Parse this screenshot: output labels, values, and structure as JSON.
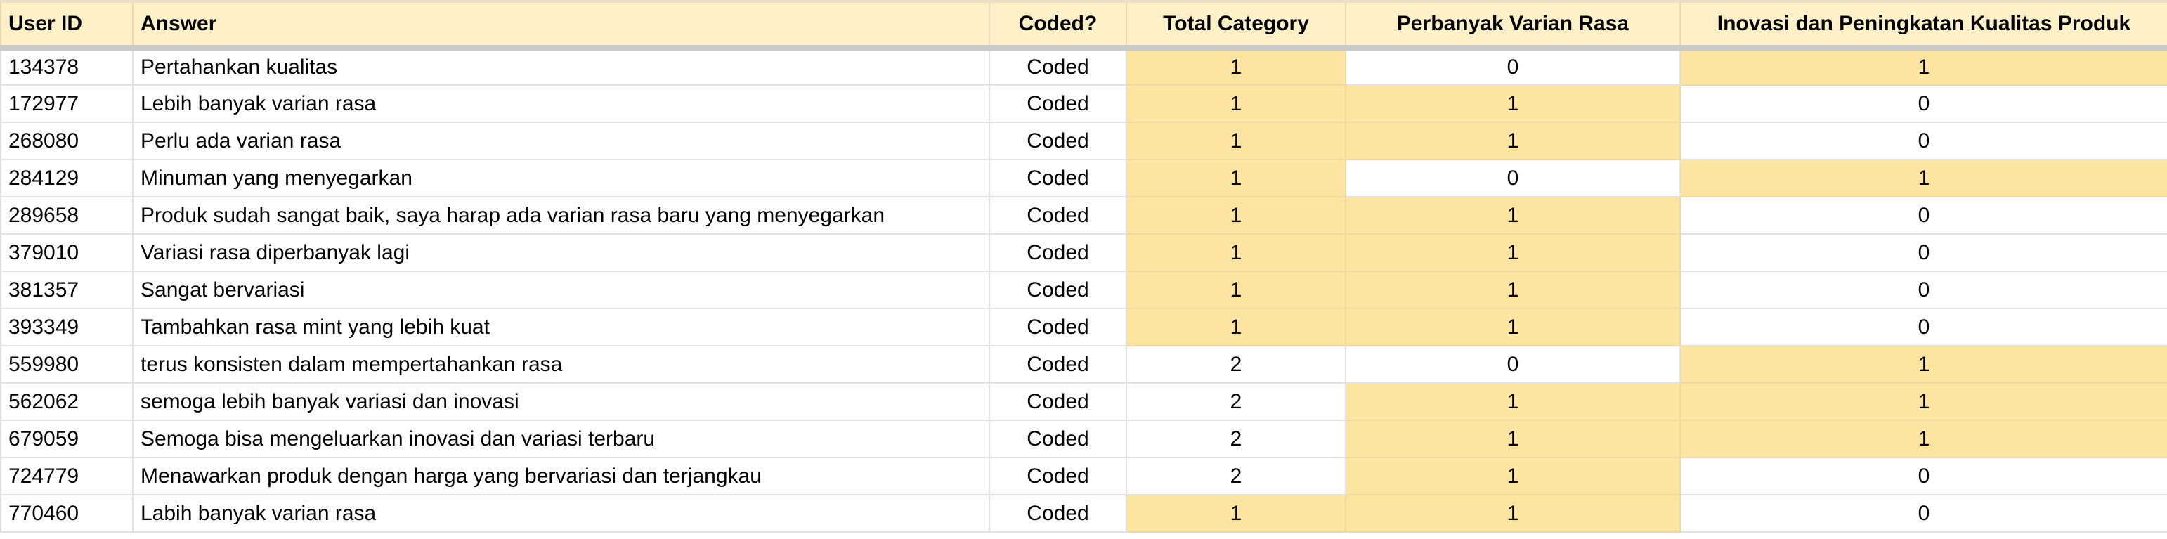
{
  "sheet": {
    "columns": [
      {
        "key": "user_id",
        "label": "User ID"
      },
      {
        "key": "answer",
        "label": "Answer"
      },
      {
        "key": "coded",
        "label": "Coded?"
      },
      {
        "key": "total_category",
        "label": "Total Category"
      },
      {
        "key": "perbanyak_varian_rasa",
        "label": "Perbanyak Varian Rasa"
      },
      {
        "key": "inovasi",
        "label": "Inovasi dan Peningkatan Kualitas Produk"
      }
    ],
    "highlight_color": "#fde4a1",
    "header_color": "#fef1c7",
    "rows": [
      {
        "user_id": "134378",
        "answer": "Pertahankan kualitas",
        "coded": "Coded",
        "total_category": "1",
        "perbanyak_varian_rasa": "0",
        "inovasi": "1",
        "hl": [
          false,
          false,
          false,
          true,
          false,
          true
        ]
      },
      {
        "user_id": "172977",
        "answer": "Lebih banyak varian rasa",
        "coded": "Coded",
        "total_category": "1",
        "perbanyak_varian_rasa": "1",
        "inovasi": "0",
        "hl": [
          false,
          false,
          false,
          true,
          true,
          false
        ]
      },
      {
        "user_id": "268080",
        "answer": "Perlu ada varian rasa",
        "coded": "Coded",
        "total_category": "1",
        "perbanyak_varian_rasa": "1",
        "inovasi": "0",
        "hl": [
          false,
          false,
          false,
          true,
          true,
          false
        ]
      },
      {
        "user_id": "284129",
        "answer": "Minuman yang menyegarkan",
        "coded": "Coded",
        "total_category": "1",
        "perbanyak_varian_rasa": "0",
        "inovasi": "1",
        "hl": [
          false,
          false,
          false,
          true,
          false,
          true
        ]
      },
      {
        "user_id": "289658",
        "answer": "Produk sudah sangat baik, saya harap ada varian rasa baru yang menyegarkan",
        "coded": "Coded",
        "total_category": "1",
        "perbanyak_varian_rasa": "1",
        "inovasi": "0",
        "hl": [
          false,
          false,
          false,
          true,
          true,
          false
        ]
      },
      {
        "user_id": "379010",
        "answer": "Variasi rasa diperbanyak lagi",
        "coded": "Coded",
        "total_category": "1",
        "perbanyak_varian_rasa": "1",
        "inovasi": "0",
        "hl": [
          false,
          false,
          false,
          true,
          true,
          false
        ]
      },
      {
        "user_id": "381357",
        "answer": "Sangat bervariasi",
        "coded": "Coded",
        "total_category": "1",
        "perbanyak_varian_rasa": "1",
        "inovasi": "0",
        "hl": [
          false,
          false,
          false,
          true,
          true,
          false
        ]
      },
      {
        "user_id": "393349",
        "answer": "Tambahkan rasa mint yang lebih kuat",
        "coded": "Coded",
        "total_category": "1",
        "perbanyak_varian_rasa": "1",
        "inovasi": "0",
        "hl": [
          false,
          false,
          false,
          true,
          true,
          false
        ]
      },
      {
        "user_id": "559980",
        "answer": "terus konsisten dalam mempertahankan rasa",
        "coded": "Coded",
        "total_category": "2",
        "perbanyak_varian_rasa": "0",
        "inovasi": "1",
        "hl": [
          false,
          false,
          false,
          false,
          false,
          true
        ]
      },
      {
        "user_id": "562062",
        "answer": "semoga lebih banyak variasi dan inovasi",
        "coded": "Coded",
        "total_category": "2",
        "perbanyak_varian_rasa": "1",
        "inovasi": "1",
        "hl": [
          false,
          false,
          false,
          false,
          true,
          true
        ]
      },
      {
        "user_id": "679059",
        "answer": "Semoga bisa mengeluarkan inovasi dan variasi terbaru",
        "coded": "Coded",
        "total_category": "2",
        "perbanyak_varian_rasa": "1",
        "inovasi": "1",
        "hl": [
          false,
          false,
          false,
          false,
          true,
          true
        ]
      },
      {
        "user_id": "724779",
        "answer": "Menawarkan produk dengan harga yang bervariasi dan terjangkau",
        "coded": "Coded",
        "total_category": "2",
        "perbanyak_varian_rasa": "1",
        "inovasi": "0",
        "hl": [
          false,
          false,
          false,
          false,
          true,
          false
        ]
      },
      {
        "user_id": "770460",
        "answer": "Labih banyak varian rasa",
        "coded": "Coded",
        "total_category": "1",
        "perbanyak_varian_rasa": "1",
        "inovasi": "0",
        "hl": [
          false,
          false,
          false,
          true,
          true,
          false
        ]
      }
    ]
  }
}
